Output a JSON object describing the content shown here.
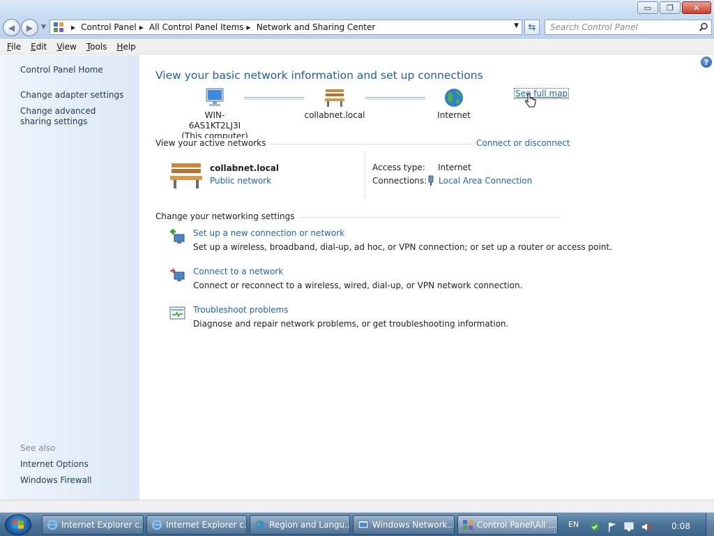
{
  "window": {
    "buttons": {
      "minimize": "▭",
      "maximize": "❐",
      "close": "✕"
    }
  },
  "address": {
    "breadcrumb": [
      "Control Panel",
      "All Control Panel Items",
      "Network and Sharing Center"
    ],
    "search_placeholder": "Search Control Panel"
  },
  "menu": [
    "File",
    "Edit",
    "View",
    "Tools",
    "Help"
  ],
  "sidebar": {
    "home": "Control Panel Home",
    "links": [
      "Change adapter settings",
      "Change advanced sharing settings"
    ],
    "see_also_label": "See also",
    "see_also": [
      "Internet Options",
      "Windows Firewall"
    ]
  },
  "main": {
    "heading": "View your basic network information and set up connections",
    "map": {
      "computer_name": "WIN-6AS1KT2LJ3I",
      "computer_sub": "(This computer)",
      "network_name": "collabnet.local",
      "internet": "Internet",
      "see_full_map": "See full map"
    },
    "active": {
      "label": "View your active networks",
      "connect_link": "Connect or disconnect",
      "network_name": "collabnet.local",
      "network_type": "Public network",
      "access_type_label": "Access type:",
      "access_type_value": "Internet",
      "connections_label": "Connections:",
      "connections_value": "Local Area Connection"
    },
    "settings": {
      "label": "Change your networking settings",
      "tasks": [
        {
          "title": "Set up a new connection or network",
          "desc": "Set up a wireless, broadband, dial-up, ad hoc, or VPN connection; or set up a router or access point."
        },
        {
          "title": "Connect to a network",
          "desc": "Connect or reconnect to a wireless, wired, dial-up, or VPN network connection."
        },
        {
          "title": "Troubleshoot problems",
          "desc": "Diagnose and repair network problems, or get troubleshooting information."
        }
      ]
    }
  },
  "taskbar": {
    "buttons": [
      "Internet Explorer c...",
      "Internet Explorer c...",
      "Region and Langu...",
      "Windows Network...",
      "Control Panel\\All ..."
    ],
    "language": "EN",
    "time": "0:08"
  },
  "colors": {
    "link": "#1e64b4",
    "heading": "#1e5ea8",
    "sidebar_link": "#1e395b"
  },
  "icons": [
    "control-panel-icon",
    "back-arrow-icon",
    "forward-arrow-icon",
    "refresh-icon",
    "search-icon",
    "help-icon",
    "computer-icon",
    "bench-icon",
    "globe-icon",
    "connection-plug-icon",
    "new-connection-icon",
    "connect-network-icon",
    "troubleshoot-icon",
    "windows-logo-icon",
    "internet-explorer-icon",
    "action-center-flag-icon",
    "network-tray-icon",
    "volume-muted-icon"
  ]
}
